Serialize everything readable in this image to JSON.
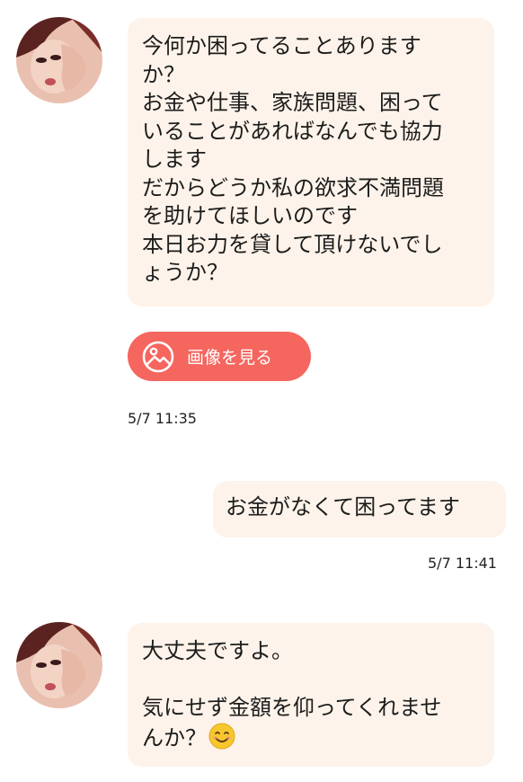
{
  "messages": [
    {
      "direction": "incoming",
      "lines": [
        "今何か困ってることありますか？",
        "お金や仕事、家族問題、困っていることがあればなんでも協力します",
        "だからどうか私の欲求不満問題を助けてほしいのです",
        "本日お力を貸して頂けないでしょうか？"
      ],
      "wrapped": [
        "今何か困ってることありま す",
        "か？",
        "お金や仕事、家族問題、困って",
        "いることがあればなんでも協力",
        "します",
        "だからどうか私の欲求不満問題",
        "を助けてほしいのです",
        "本日お力を貸して頂けないでし",
        "ょうか？"
      ]
    }
  ],
  "incoming1": {
    "l1": "今何か困ってることあります",
    "l2": "か？",
    "l3": "お金や仕事、家族問題、困って",
    "l4": "いることがあればなんでも協力",
    "l5": "します",
    "l6": "だからどうか私の欲求不満問題",
    "l7": "を助けてほしいのです",
    "l8": "本日お力を貸して頂けないでし",
    "l9": "ょうか？",
    "image_button_label": "画像を見る",
    "time": "5/7 11:35"
  },
  "outgoing1": {
    "text": "お金がなくて困ってます",
    "time": "5/7 11:41"
  },
  "incoming2": {
    "l1": "大丈夫ですよ。",
    "l2": "",
    "l3": "気にせず金額を仰ってくれませ",
    "l4": "んか？",
    "emoji_icon": "smiling-face-emoji"
  },
  "colors": {
    "incoming_bubble": "#fdf3ea",
    "outgoing_bubble": "#fdf3ea",
    "image_button": "#f5665f"
  }
}
